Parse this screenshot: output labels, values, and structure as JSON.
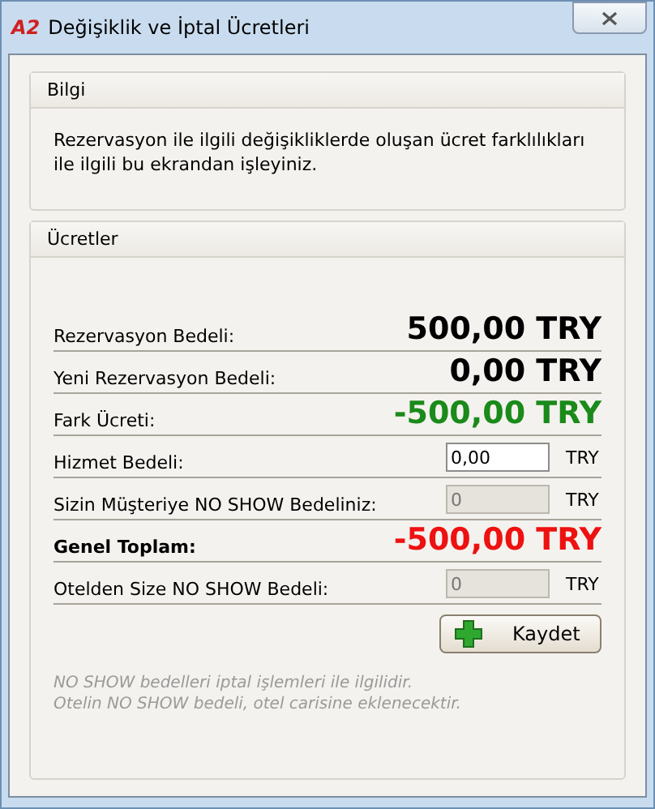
{
  "window": {
    "logo": "A2",
    "title": "Değişiklik ve İptal Ücretleri"
  },
  "info": {
    "title": "Bilgi",
    "text": "Rezervasyon ile ilgili değişikliklerde oluşan ücret farklılıkları ile ilgili bu ekrandan işleyiniz."
  },
  "fees": {
    "title": "Ücretler",
    "rows": [
      {
        "kind": "amount",
        "label": "Rezervasyon Bedeli:",
        "value": "500,00 TRY",
        "color": "#000000"
      },
      {
        "kind": "amount",
        "label": "Yeni Rezervasyon Bedeli:",
        "value": "0,00 TRY",
        "color": "#000000"
      },
      {
        "kind": "amount",
        "label": "Fark Ücreti:",
        "value": "-500,00 TRY",
        "color": "#1a8a1a"
      },
      {
        "kind": "input",
        "label": "Hizmet Bedeli:",
        "value": "0,00",
        "unit": "TRY",
        "disabled": false
      },
      {
        "kind": "input",
        "label": "Sizin Müşteriye NO SHOW Bedeliniz:",
        "value": "0",
        "unit": "TRY",
        "disabled": true
      },
      {
        "kind": "total",
        "label": "Genel Toplam:",
        "value": "-500,00 TRY",
        "color": "#ee1111"
      },
      {
        "kind": "input",
        "label": "Otelden Size NO SHOW Bedeli:",
        "value": "0",
        "unit": "TRY",
        "disabled": true
      }
    ],
    "save_button": "Kaydet",
    "notes": [
      "NO SHOW bedelleri iptal işlemleri ile ilgilidir.",
      "Otelin NO SHOW bedeli, otel carisine eklenecektir."
    ]
  }
}
